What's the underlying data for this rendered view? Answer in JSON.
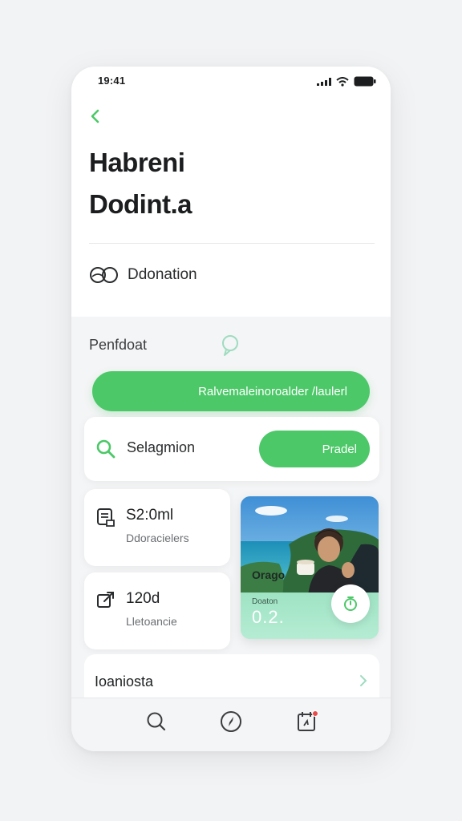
{
  "status_bar": {
    "time": "19:41"
  },
  "header": {
    "title_line1": "Habreni",
    "title_line2": "Dodint.a"
  },
  "donation": {
    "label": "Ddonation",
    "icon": "link-icon"
  },
  "section": {
    "label": "Penfdoat",
    "icon": "chat-bubble-icon"
  },
  "cta": {
    "label": "Ralvemaleinoroalder /laulerl"
  },
  "search_card": {
    "label": "Selagmion",
    "button_label": "Pradel"
  },
  "stats": [
    {
      "value": "S2:0ml",
      "sub": "Ddoracielers",
      "icon": "document-icon"
    },
    {
      "value": "120d",
      "sub": "Lletoancie",
      "icon": "external-link-icon"
    }
  ],
  "photo_card": {
    "caption": "Orago",
    "small_label": "Doaton",
    "value": "0.2.",
    "action_icon": "timer-icon"
  },
  "list_row": {
    "label": "Ioaniosta"
  },
  "tab_bar": {
    "items": [
      {
        "icon": "search-icon"
      },
      {
        "icon": "compass-icon"
      },
      {
        "icon": "calendar-icon"
      }
    ]
  },
  "colors": {
    "accent": "#4cc868",
    "card": "#ffffff",
    "background": "#f4f5f6",
    "photo_tint": "#a8e6c9"
  }
}
